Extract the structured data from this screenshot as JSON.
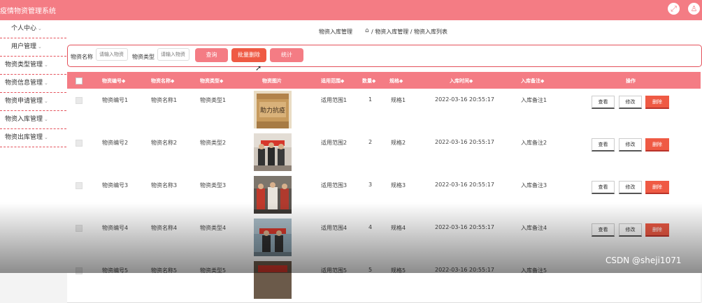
{
  "app": {
    "title": "疫情物资管理系统"
  },
  "topbar": {
    "icons": [
      "fullscreen-icon",
      "user-icon"
    ]
  },
  "sidebar": {
    "items": [
      {
        "label": "个人中心"
      },
      {
        "label": "用户管理"
      },
      {
        "label": "物资类型管理"
      },
      {
        "label": "物资信息管理"
      },
      {
        "label": "物资申请管理"
      },
      {
        "label": "物资入库管理"
      },
      {
        "label": "物资出库管理"
      }
    ]
  },
  "breadcrumb": {
    "title": "物资入库管理",
    "path": "/ 物资入库管理 / 物资入库列表"
  },
  "search": {
    "name_label": "物资名称",
    "name_placeholder": "请输入物资",
    "type_label": "物资类型",
    "type_placeholder": "请输入物资",
    "search_btn": "查询",
    "batch_delete_btn": "批量删除",
    "stats_btn": "统计"
  },
  "table": {
    "headers": [
      "物资编号◆",
      "物资名称◆",
      "物资类型◆",
      "物资图片",
      "适用范围◆",
      "数量◆",
      "规格◆",
      "入库时间◆",
      "入库备注◆",
      "操作"
    ],
    "rows": [
      {
        "code": "物资编号1",
        "name": "物资名称1",
        "type": "物资类型1",
        "scope": "适用范围1",
        "qty": "1",
        "spec": "规格1",
        "time": "2022-03-16 20:55:17",
        "note": "入库备注1"
      },
      {
        "code": "物资编号2",
        "name": "物资名称2",
        "type": "物资类型2",
        "scope": "适用范围2",
        "qty": "2",
        "spec": "规格2",
        "time": "2022-03-16 20:55:17",
        "note": "入库备注2"
      },
      {
        "code": "物资编号3",
        "name": "物资名称3",
        "type": "物资类型3",
        "scope": "适用范围3",
        "qty": "3",
        "spec": "规格3",
        "time": "2022-03-16 20:55:17",
        "note": "入库备注3"
      },
      {
        "code": "物资编号4",
        "name": "物资名称4",
        "type": "物资类型4",
        "scope": "适用范围4",
        "qty": "4",
        "spec": "规格4",
        "time": "2022-03-16 20:55:17",
        "note": "入库备注4"
      },
      {
        "code": "物资编号5",
        "name": "物资名称5",
        "type": "物资类型5",
        "scope": "适用范围5",
        "qty": "5",
        "spec": "规格5",
        "time": "2022-03-16 20:55:17",
        "note": "入库备注5"
      }
    ],
    "actions": {
      "view": "查看",
      "edit": "修改",
      "delete": "删除"
    },
    "thumb_text": "助力抗疫"
  },
  "watermark": "CSDN @sheji1071",
  "colors": {
    "accent": "#f47c84",
    "danger": "#ef5a44",
    "border": "#e4505a"
  }
}
